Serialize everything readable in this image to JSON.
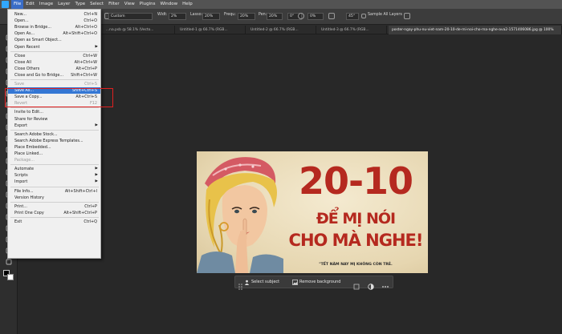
{
  "menubar": {
    "items": [
      "File",
      "Edit",
      "Image",
      "Layer",
      "Type",
      "Select",
      "Filter",
      "View",
      "Plugins",
      "Window",
      "Help"
    ],
    "active_index": 0
  },
  "options_bar": {
    "style_label": "Custom",
    "width_label": "Widt:",
    "width_value": "2%",
    "lasso_label": "Lasso:",
    "lasso_value": "20%",
    "freq_label": "Frequ:",
    "freq_value": "20%",
    "pen_label": "Pen:",
    "pen_value": "20%",
    "angle_value": "0°",
    "smooth_value": "0%",
    "degrees_value": "45°",
    "sample_label": "Sample All Layers"
  },
  "tabs": [
    "...na.psb @ 58.1% (Vecto...",
    "Untitled-1 @ 66.7% (RGB...",
    "Untitled-2 @ 66.7% (RGB...",
    "Untitled-3 @ 66.7% (RGB...",
    "poster-ngay-phu-nu-viet-nam-20-10-de-mi-noi-cho-ma-nghe-ava2-1571406086.jpg @ 100%"
  ],
  "file_menu": [
    {
      "label": "New...",
      "shortcut": "Ctrl+N"
    },
    {
      "label": "Open...",
      "shortcut": "Ctrl+O"
    },
    {
      "label": "Browse in Bridge...",
      "shortcut": "Alt+Ctrl+O"
    },
    {
      "label": "Open As...",
      "shortcut": "Alt+Shift+Ctrl+O"
    },
    {
      "label": "Open as Smart Object...",
      "shortcut": ""
    },
    {
      "label": "Open Recent",
      "shortcut": "",
      "submenu": true
    },
    {
      "separator": true
    },
    {
      "label": "Close",
      "shortcut": "Ctrl+W"
    },
    {
      "label": "Close All",
      "shortcut": "Alt+Ctrl+W"
    },
    {
      "label": "Close Others",
      "shortcut": "Alt+Ctrl+P"
    },
    {
      "label": "Close and Go to Bridge...",
      "shortcut": "Shift+Ctrl+W"
    },
    {
      "separator": true
    },
    {
      "label": "Save",
      "shortcut": "Ctrl+S",
      "disabled": true
    },
    {
      "label": "Save As...",
      "shortcut": "Shift+Ctrl+S",
      "highlighted": true
    },
    {
      "label": "Save a Copy...",
      "shortcut": "Alt+Ctrl+S"
    },
    {
      "label": "Revert",
      "shortcut": "F12",
      "disabled": true
    },
    {
      "separator": true
    },
    {
      "label": "Invite to Edit...",
      "shortcut": ""
    },
    {
      "label": "Share for Review",
      "shortcut": ""
    },
    {
      "label": "Export",
      "shortcut": "",
      "submenu": true
    },
    {
      "separator": true
    },
    {
      "label": "Search Adobe Stock...",
      "shortcut": ""
    },
    {
      "label": "Search Adobe Express Templates...",
      "shortcut": ""
    },
    {
      "label": "Place Embedded...",
      "shortcut": ""
    },
    {
      "label": "Place Linked...",
      "shortcut": ""
    },
    {
      "label": "Package...",
      "shortcut": "",
      "disabled": true
    },
    {
      "separator": true
    },
    {
      "label": "Automate",
      "shortcut": "",
      "submenu": true
    },
    {
      "label": "Scripts",
      "shortcut": "",
      "submenu": true
    },
    {
      "label": "Import",
      "shortcut": "",
      "submenu": true
    },
    {
      "separator": true
    },
    {
      "label": "File Info...",
      "shortcut": "Alt+Shift+Ctrl+I"
    },
    {
      "label": "Version History",
      "shortcut": ""
    },
    {
      "separator": true
    },
    {
      "label": "Print...",
      "shortcut": "Ctrl+P"
    },
    {
      "label": "Print One Copy",
      "shortcut": "Alt+Shift+Ctrl+P"
    },
    {
      "separator": true
    },
    {
      "label": "Exit",
      "shortcut": "Ctrl+Q"
    }
  ],
  "poster": {
    "line1": "20-10",
    "line2": "ĐỂ MỊ NÓI",
    "line3": "CHO MÀ NGHE!",
    "tagline": "\"TẾT NĂM NAY MỊ KHÔNG CÒN TRẺ."
  },
  "context_bar": {
    "select_subject": "Select subject",
    "remove_background": "Remove background"
  },
  "colors": {
    "menubar": "#535353",
    "menu_highlight": "#3477d4",
    "annotation": "#e02020",
    "poster_text": "#b5291f"
  }
}
